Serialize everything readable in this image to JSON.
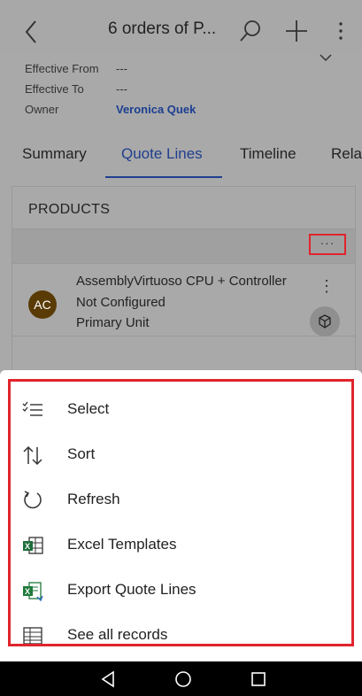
{
  "header": {
    "title": "6 orders of P..."
  },
  "fields": [
    {
      "label": "Effective From",
      "value": "---"
    },
    {
      "label": "Effective To",
      "value": "---"
    },
    {
      "label": "Owner",
      "value": "Veronica Quek"
    }
  ],
  "tabs": [
    {
      "label": "Summary"
    },
    {
      "label": "Quote Lines"
    },
    {
      "label": "Timeline"
    },
    {
      "label": "Rela"
    }
  ],
  "products": {
    "title": "PRODUCTS",
    "more_label": "···",
    "item": {
      "avatar": "AC",
      "name": "AssemblyVirtuoso CPU + Controller",
      "status": "Not Configured",
      "unit": "Primary Unit",
      "more_label": "⋮"
    }
  },
  "menu": {
    "items": [
      {
        "label": "Select",
        "icon": "select-list-icon"
      },
      {
        "label": "Sort",
        "icon": "sort-arrows-icon"
      },
      {
        "label": "Refresh",
        "icon": "refresh-icon"
      },
      {
        "label": "Excel Templates",
        "icon": "excel-templates-icon"
      },
      {
        "label": "Export Quote Lines",
        "icon": "excel-export-icon"
      },
      {
        "label": "See all records",
        "icon": "table-icon"
      }
    ]
  },
  "colors": {
    "accent": "#1f3f8e",
    "highlight": "#e0242c",
    "overlay": "#a9a9a9"
  }
}
